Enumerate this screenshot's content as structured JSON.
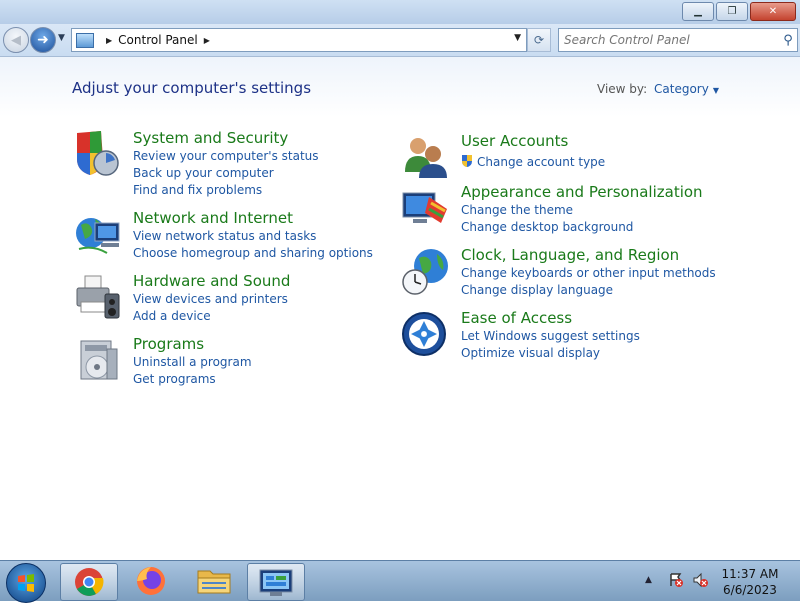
{
  "window": {
    "minimize": "▁",
    "restore": "❐",
    "close": "✕"
  },
  "nav": {
    "back_glyph": "◀",
    "forward_glyph": "➜",
    "recent_glyph": "▼"
  },
  "address": {
    "crumb": "Control Panel",
    "sep": "▶",
    "dropdown": "▼",
    "refresh_glyph": "⟳"
  },
  "search": {
    "placeholder": "Search Control Panel",
    "icon": "⚲"
  },
  "page": {
    "heading": "Adjust your computer's settings",
    "view_by_label": "View by:",
    "view_by_value": "Category",
    "caret": "▼"
  },
  "categories_left": [
    {
      "title": "System and Security",
      "links": [
        "Review your computer's status",
        "Back up your computer",
        "Find and fix problems"
      ]
    },
    {
      "title": "Network and Internet",
      "links": [
        "View network status and tasks",
        "Choose homegroup and sharing options"
      ]
    },
    {
      "title": "Hardware and Sound",
      "links": [
        "View devices and printers",
        "Add a device"
      ]
    },
    {
      "title": "Programs",
      "links": [
        "Uninstall a program",
        "Get programs"
      ]
    }
  ],
  "categories_right": [
    {
      "title": "User Accounts",
      "links": [
        "Change account type"
      ]
    },
    {
      "title": "Appearance and Personalization",
      "links": [
        "Change the theme",
        "Change desktop background"
      ]
    },
    {
      "title": "Clock, Language, and Region",
      "links": [
        "Change keyboards or other input methods",
        "Change display language"
      ]
    },
    {
      "title": "Ease of Access",
      "links": [
        "Let Windows suggest settings",
        "Optimize visual display"
      ]
    }
  ],
  "taskbar": {
    "tray_up": "▲",
    "time": "11:37 AM",
    "date": "6/6/2023"
  },
  "colors": {
    "category_title": "#1a7a1a",
    "link": "#1f57a3",
    "heading": "#1e3287"
  }
}
